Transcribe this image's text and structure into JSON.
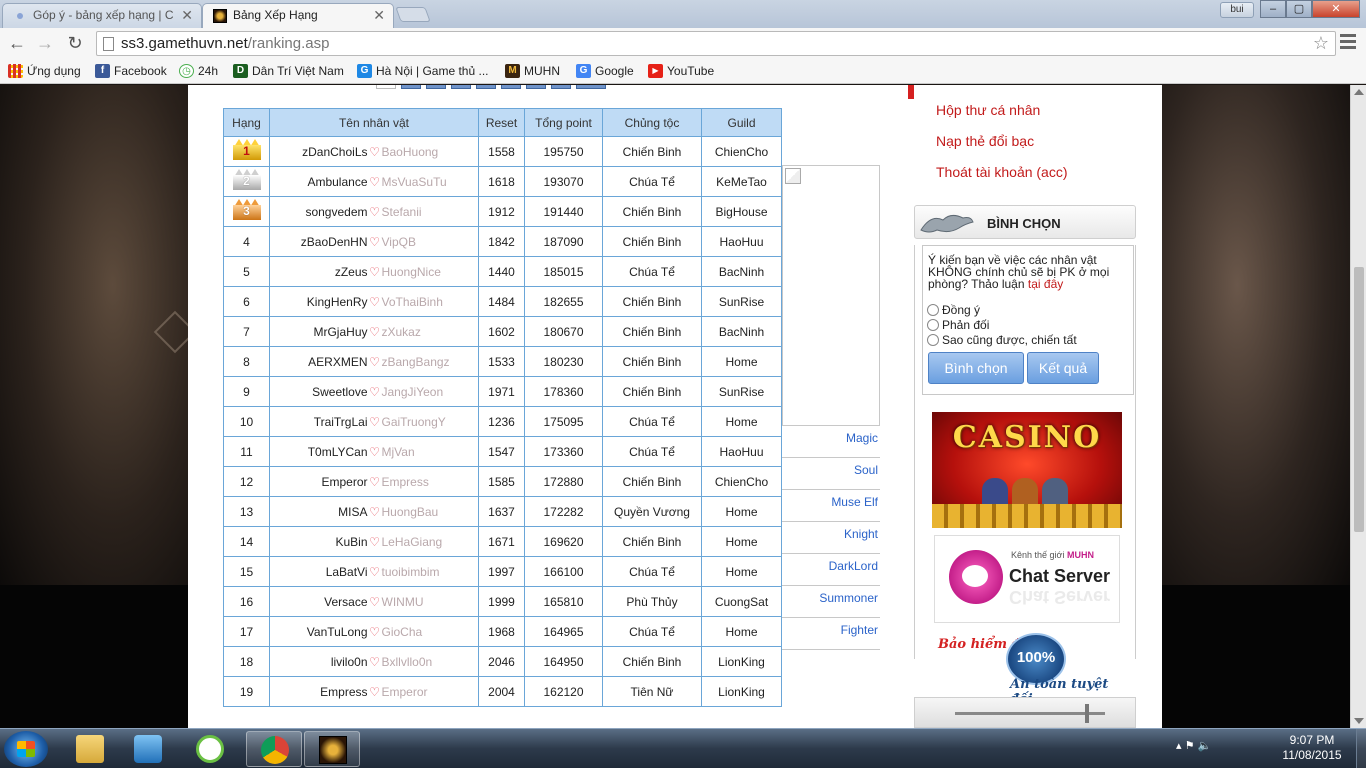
{
  "browser": {
    "tabs": [
      {
        "title": "Góp ý - bảng xếp hạng | C",
        "active": false
      },
      {
        "title": "Bảng Xếp Hạng",
        "active": true
      }
    ],
    "user_badge": "bui",
    "win_min": "‒",
    "win_max": "▢",
    "win_close": "✕",
    "tab_close": "✕",
    "nav_back": "←",
    "nav_forward": "→",
    "nav_reload": "↻",
    "url_host": "ss3.gamethuvn.net",
    "url_path": "/ranking.asp",
    "bookmarks": [
      {
        "label": "Ứng dụng",
        "icon": "apps-grid-icon",
        "color": "#d93025"
      },
      {
        "label": "Facebook",
        "icon": "facebook-icon",
        "color": "#3b5998"
      },
      {
        "label": "24h",
        "icon": "24h-icon",
        "color": "#4caf50"
      },
      {
        "label": "Dân Trí Việt Nam",
        "icon": "dantri-icon",
        "color": "#1b5e20"
      },
      {
        "label": "Hà Nội | Game thủ ...",
        "icon": "game-g-icon",
        "color": "#1e88e5"
      },
      {
        "label": "MUHN",
        "icon": "muhn-icon",
        "color": "#3a2410"
      },
      {
        "label": "Google",
        "icon": "google-icon",
        "color": "#4285f4"
      },
      {
        "label": "YouTube",
        "icon": "youtube-icon",
        "color": "#e62117"
      }
    ],
    "bookmark_glyphs": {
      "facebook": "f",
      "24h": "◷",
      "dantri": "D",
      "game": "G",
      "muhn": "M",
      "google": "G",
      "youtube": "▶"
    }
  },
  "ranking": {
    "headers": {
      "rank": "Hạng",
      "name": "Tên nhân vật",
      "reset": "Reset",
      "point": "Tổng point",
      "race": "Chủng tộc",
      "guild": "Guild"
    },
    "heart": "♡",
    "rows": [
      {
        "rank": "1",
        "name": "zDanChoiLs",
        "partner": "BaoHuong",
        "reset": "1558",
        "point": "195750",
        "race": "Chiến Binh",
        "race_key": "cb",
        "guild": "ChienCho"
      },
      {
        "rank": "2",
        "name": "Ambulance",
        "partner": "MsVuaSuTu",
        "reset": "1618",
        "point": "193070",
        "race": "Chúa Tể",
        "race_key": "ct",
        "guild": "KeMeTao"
      },
      {
        "rank": "3",
        "name": "songvedem",
        "partner": "Stefanii",
        "reset": "1912",
        "point": "191440",
        "race": "Chiến Binh",
        "race_key": "cb",
        "guild": "BigHouse"
      },
      {
        "rank": "4",
        "name": "zBaoDenHN",
        "partner": "VipQB",
        "reset": "1842",
        "point": "187090",
        "race": "Chiến Binh",
        "race_key": "cb",
        "guild": "HaoHuu"
      },
      {
        "rank": "5",
        "name": "zZeus",
        "partner": "HuongNice",
        "reset": "1440",
        "point": "185015",
        "race": "Chúa Tể",
        "race_key": "ct",
        "guild": "BacNinh"
      },
      {
        "rank": "6",
        "name": "KingHenRy",
        "partner": "VoThaiBinh",
        "reset": "1484",
        "point": "182655",
        "race": "Chiến Binh",
        "race_key": "cb",
        "guild": "SunRise"
      },
      {
        "rank": "7",
        "name": "MrGjaHuy",
        "partner": "zXukaz",
        "reset": "1602",
        "point": "180670",
        "race": "Chiến Binh",
        "race_key": "cb",
        "guild": "BacNinh"
      },
      {
        "rank": "8",
        "name": "AERXMEN",
        "partner": "zBangBangz",
        "reset": "1533",
        "point": "180230",
        "race": "Chiến Binh",
        "race_key": "cb",
        "guild": "Home"
      },
      {
        "rank": "9",
        "name": "Sweetlove",
        "partner": "JangJiYeon",
        "reset": "1971",
        "point": "178360",
        "race": "Chiến Binh",
        "race_key": "cb",
        "guild": "SunRise"
      },
      {
        "rank": "10",
        "name": "TraiTrgLai",
        "partner": "GaiTruongY",
        "reset": "1236",
        "point": "175095",
        "race": "Chúa Tể",
        "race_key": "ct",
        "guild": "Home"
      },
      {
        "rank": "11",
        "name": "T0mLYCan",
        "partner": "MjVan",
        "reset": "1547",
        "point": "173360",
        "race": "Chúa Tể",
        "race_key": "ct",
        "guild": "HaoHuu"
      },
      {
        "rank": "12",
        "name": "Emperor",
        "partner": "Empress",
        "reset": "1585",
        "point": "172880",
        "race": "Chiến Binh",
        "race_key": "cb",
        "guild": "ChienCho"
      },
      {
        "rank": "13",
        "name": "MISA",
        "partner": "HuongBau",
        "reset": "1637",
        "point": "172282",
        "race": "Quyền Vương",
        "race_key": "qv",
        "guild": "Home"
      },
      {
        "rank": "14",
        "name": "KuBin",
        "partner": "LeHaGiang",
        "reset": "1671",
        "point": "169620",
        "race": "Chiến Binh",
        "race_key": "cb",
        "guild": "Home"
      },
      {
        "rank": "15",
        "name": "LaBatVi",
        "partner": "tuoibimbim",
        "reset": "1997",
        "point": "166100",
        "race": "Chúa Tể",
        "race_key": "ct",
        "guild": "Home"
      },
      {
        "rank": "16",
        "name": "Versace",
        "partner": "WINMU",
        "reset": "1999",
        "point": "165810",
        "race": "Phù Thủy",
        "race_key": "pt",
        "guild": "CuongSat"
      },
      {
        "rank": "17",
        "name": "VanTuLong",
        "partner": "GioCha",
        "reset": "1968",
        "point": "164965",
        "race": "Chúa Tể",
        "race_key": "ct",
        "guild": "Home"
      },
      {
        "rank": "18",
        "name": "livilo0n",
        "partner": "Bxllvllo0n",
        "reset": "2046",
        "point": "164950",
        "race": "Chiến Binh",
        "race_key": "cb",
        "guild": "LionKing"
      },
      {
        "rank": "19",
        "name": "Empress",
        "partner": "Emperor",
        "reset": "2004",
        "point": "162120",
        "race": "Tiên Nữ",
        "race_key": "tn",
        "guild": "LionKing"
      }
    ]
  },
  "class_links": [
    "Magic",
    "Soul",
    "Muse Elf",
    "Knight",
    "DarkLord",
    "Summoner",
    "Fighter"
  ],
  "sidebar": {
    "account_links": [
      "Hộp thư cá nhân",
      "Nạp thẻ đổi bạc",
      "Thoát tài khoản (acc)"
    ],
    "vote": {
      "title": "BÌNH CHỌN",
      "question": "Ý kiến bạn về việc các nhân vật KHÔNG chính chủ sẽ bị PK ở mọi phòng? Thảo luận",
      "question_link": "tại đây",
      "options": [
        "Đồng ý",
        "Phản đối",
        "Sao cũng được, chiến tất"
      ],
      "vote_button": "Bình chọn",
      "result_button": "Kết quả"
    },
    "casino_text": "CASINO",
    "chat_tag_prefix": "Kênh thế giới",
    "chat_tag_brand": "MUHN",
    "chat_title": "Chat Server",
    "insurance_top": "Bảo hiểm đỏ",
    "insurance_seal": "100%",
    "insurance_bottom": "An toàn tuyệt đối"
  },
  "taskbar": {
    "time": "9:07 PM",
    "date": "11/08/2015",
    "tray_glyphs": "▴  ⚑  🔈"
  },
  "colors": {
    "link_blue": "#2b63c9",
    "link_red": "#c21b1b",
    "header_blue": "#bfdbf5",
    "border_blue": "#6aa6d8"
  }
}
